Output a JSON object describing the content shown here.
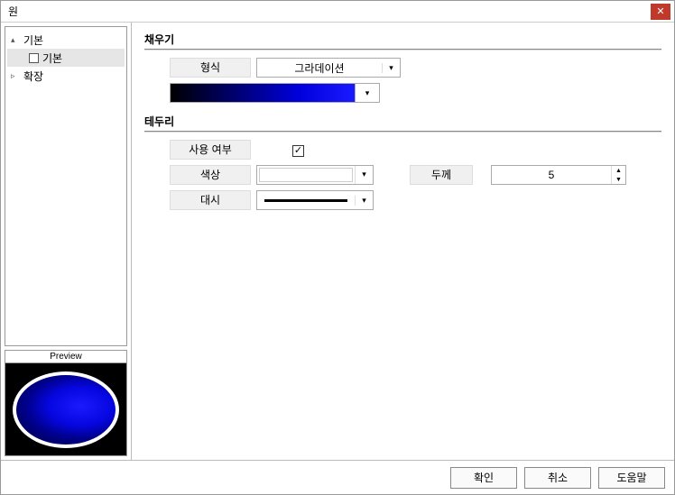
{
  "window": {
    "title": "원"
  },
  "sidebar": {
    "items": [
      {
        "expander": "▴",
        "label": "기본"
      },
      {
        "label": "기본",
        "selected": true
      },
      {
        "expander": "▹",
        "label": "확장"
      }
    ],
    "preview_label": "Preview"
  },
  "sections": {
    "fill": {
      "title": "채우기",
      "type_label": "형식",
      "type_value": "그라데이션"
    },
    "border": {
      "title": "테두리",
      "use_label": "사용 여부",
      "use_checked": "✓",
      "color_label": "색상",
      "thickness_label": "두께",
      "thickness_value": "5",
      "dash_label": "대시"
    }
  },
  "footer": {
    "ok": "확인",
    "cancel": "취소",
    "help": "도움말"
  }
}
